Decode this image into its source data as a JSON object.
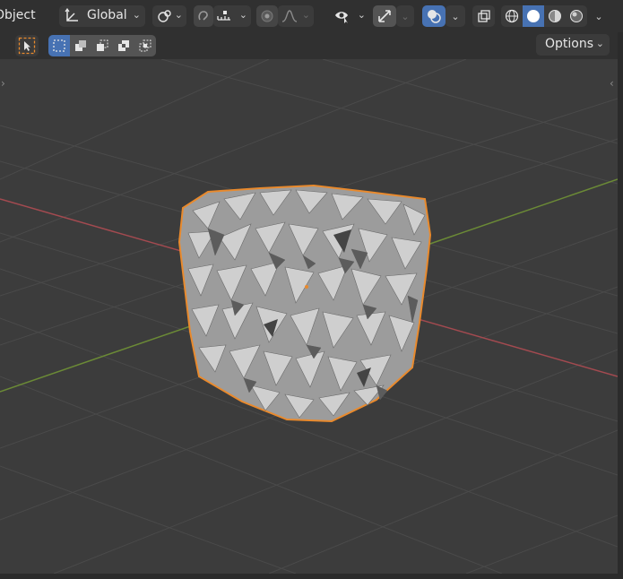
{
  "header": {
    "mode_label": "Object",
    "orientation": {
      "label": "Global",
      "icon": "transform-orientation-icon"
    },
    "pivot_icon": "pivot-point-icon",
    "snap": {
      "icon": "snap-icon",
      "target_icon": "snap-increment-icon"
    },
    "proportional": {
      "icon": "proportional-editing-icon",
      "falloff_icon": "falloff-curve-icon"
    },
    "visibility_icon": "eye-selectability-icon",
    "gizmo_icon": "gizmo-icon",
    "overlay_icon": "overlays-icon",
    "xray_icon": "xray-toggle-icon",
    "shading": {
      "modes": [
        "wireframe",
        "solid",
        "material-preview",
        "rendered"
      ],
      "active": "solid"
    }
  },
  "toolbar": {
    "active_tool_icon": "select-box-icon",
    "selection_modes": [
      "set",
      "extend",
      "subtract",
      "difference",
      "intersect"
    ],
    "active_mode": "set",
    "options_label": "Options"
  },
  "viewport": {
    "background": "#3c3c3c",
    "grid_color": "#4c4c4c",
    "x_axis_color": "#a34a50",
    "y_axis_color": "#6b8a36",
    "selection_outline": "#e98a2d",
    "object": "cracked-cube"
  }
}
